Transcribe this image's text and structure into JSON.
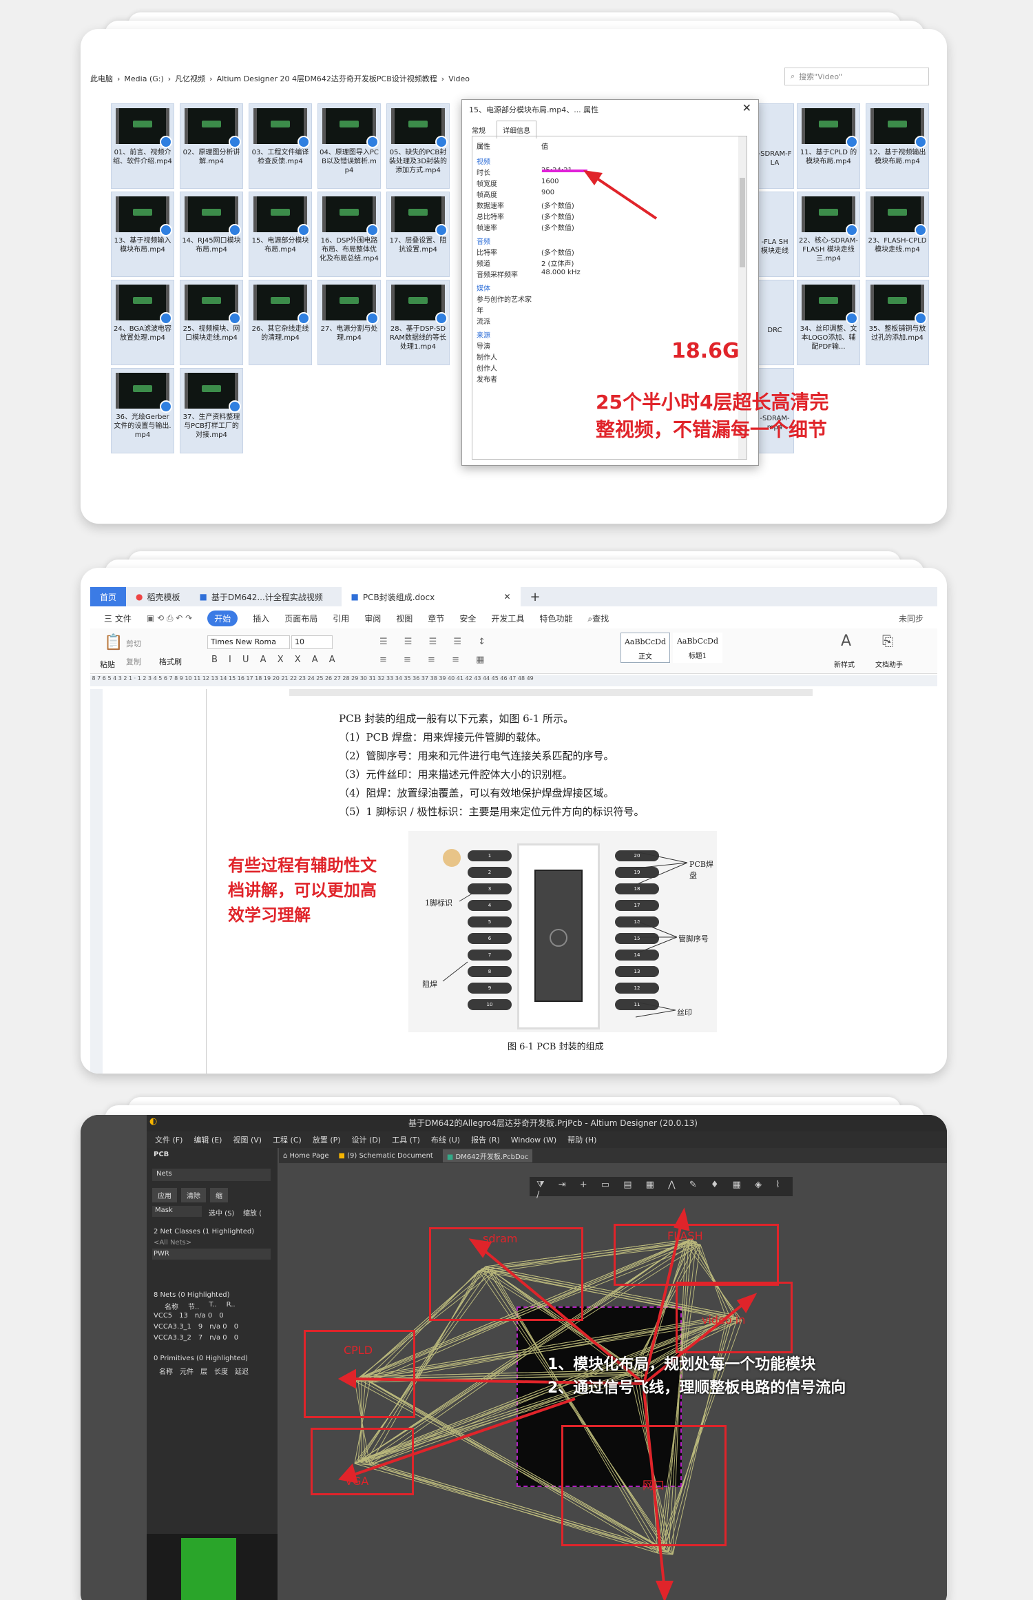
{
  "explorer": {
    "breadcrumb": [
      "此电脑",
      "Media (G:)",
      "凡亿视频",
      "Altium Designer 20 4层DM642达芬奇开发板PCB设计视频教程",
      "Video"
    ],
    "search_placeholder": "搜索\"Video\"",
    "files": [
      "01、前言、视频介绍、软件介绍.mp4",
      "02、原理图分析讲解.mp4",
      "03、工程文件编译检查反馈.mp4",
      "04、原理图导入PCB以及错误解析.mp4",
      "05、缺失的PCB封装处理及3D封装的添加方式.mp4",
      "11、基于CPLD 的模块布局.mp4",
      "12、基于视频输出模块布局.mp4",
      "13、基于视频输入模块布局.mp4",
      "14、RJ45网口模块布局.mp4",
      "15、电源部分模块布局.mp4",
      "16、DSP外围电路布局、布局整体优化及布局总结.mp4",
      "17、层叠设置、阻抗设置.mp4",
      "22、核心-SDRAM-FLASH 模块走线三.mp4",
      "23、FLASH-CPLD模块走线.mp4",
      "24、BGA滤波电容放置处理.mp4",
      "25、视频模块、网口模块走线.mp4",
      "26、其它杂线走线的清理.mp4",
      "27、电源分割与处理.mp4",
      "28、基于DSP-SDRAM数据线的等长处理1.mp4",
      "34、丝印调整、文本LOGO添加、辅配PDF输...",
      "35、整板铺铜与放过孔的添加.mp4",
      "36、光绘Gerber文件的设置与输出.mp4",
      "37、生产资料整理与PCB打样工厂的对接.mp4"
    ],
    "partial_files": [
      "-SDRAM-FLA",
      "-FLA SH 模块走线",
      "DRC",
      "-SDRAM-mp4"
    ],
    "dialog": {
      "title": "15、电源部分模块布局.mp4、... 属性",
      "tabs": [
        "常规",
        "详细信息"
      ],
      "col_headers": [
        "属性",
        "值"
      ],
      "sections": [
        {
          "header": "视频",
          "rows": [
            [
              "时长",
              "25:24:21"
            ],
            [
              "帧宽度",
              "1600"
            ],
            [
              "帧高度",
              "900"
            ],
            [
              "数据速率",
              "(多个数值)"
            ],
            [
              "总比特率",
              "(多个数值)"
            ],
            [
              "帧速率",
              "(多个数值)"
            ]
          ]
        },
        {
          "header": "音频",
          "rows": [
            [
              "比特率",
              "(多个数值)"
            ],
            [
              "频道",
              "2 (立体声)"
            ],
            [
              "音频采样频率",
              "48.000 kHz"
            ]
          ]
        },
        {
          "header": "媒体",
          "rows": [
            [
              "参与创作的艺术家",
              ""
            ],
            [
              "年",
              ""
            ],
            [
              "流派",
              ""
            ]
          ]
        },
        {
          "header": "来源",
          "rows": [
            [
              "导演",
              ""
            ],
            [
              "制作人",
              ""
            ],
            [
              "创作人",
              ""
            ],
            [
              "发布者",
              ""
            ]
          ]
        }
      ]
    },
    "size_callout": "18.6G",
    "callout": [
      "25个半小时4层超长高清完",
      "整视频，不错漏每一个细节"
    ]
  },
  "word": {
    "tabs": [
      "首页",
      "稻壳模板",
      "基于DM642...计全程实战视频",
      "PCB封装组成.docx"
    ],
    "menu": [
      "三 文件",
      "开始",
      "插入",
      "页面布局",
      "引用",
      "审阅",
      "视图",
      "章节",
      "安全",
      "开发工具",
      "特色功能",
      "查找"
    ],
    "sync_label": "未同步",
    "font_name": "Times New Roma",
    "font_size": "10",
    "styles": [
      "AaBbCcDd",
      "AaBbCcDd"
    ],
    "style_names": [
      "正文",
      "标题1"
    ],
    "ribbon_left": [
      "粘贴",
      "剪切",
      "复制",
      "格式刷"
    ],
    "ribbon_right": [
      "新样式",
      "文档助手"
    ],
    "body_lines": [
      "PCB 封装的组成一般有以下元素，如图 6-1 所示。",
      "（1）PCB 焊盘：用来焊接元件管脚的载体。",
      "（2）管脚序号：用来和元件进行电气连接关系匹配的序号。",
      "（3）元件丝印：用来描述元件腔体大小的识别框。",
      "（4）阻焊：放置绿油覆盖，可以有效地保护焊盘焊接区域。",
      "（5）1 脚标识 / 极性标识：主要是用来定位元件方向的标识符号。"
    ],
    "figure_labels": {
      "pad": "PCB焊盘",
      "pin_no": "管脚序号",
      "silk": "丝印",
      "pin1": "1脚标识",
      "mask": "阻焊"
    },
    "caption": "图 6-1   PCB 封装的组成",
    "callout": [
      "有些过程有辅助性文",
      "档讲解，可以更加高",
      "效学习理解"
    ]
  },
  "altium": {
    "title": "基于DM642的Allegro4层达芬奇开发板.PrjPcb - Altium Designer (20.0.13)",
    "menu": [
      "文件 (F)",
      "编辑 (E)",
      "视图 (V)",
      "工程 (C)",
      "放置 (P)",
      "设计 (D)",
      "工具 (T)",
      "布线 (U)",
      "报告 (R)",
      "Window (W)",
      "帮助 (H)"
    ],
    "doc_tabs": [
      "Home Page",
      "(9) Schematic Document",
      "DM642开发板.PcbDoc"
    ],
    "panel": {
      "title": "PCB",
      "dropdown": "Nets",
      "buttons": [
        "应用",
        "清除",
        "缩"
      ],
      "mask": "Mask",
      "checks": [
        "选中 (S)",
        "缩放 ("
      ],
      "net_classes_header": "2 Net Classes (1 Highlighted)",
      "net_classes": [
        "<All Nets>",
        "PWR"
      ],
      "nets_header": "8 Nets (0 Highlighted)",
      "nets_cols": [
        "名称",
        "节..",
        "T..",
        "R.."
      ],
      "nets": [
        [
          "VCC5",
          "13",
          "n/a 0",
          "0"
        ],
        [
          "VCCA3.3_1",
          "9",
          "n/a 0",
          "0"
        ],
        [
          "VCCA3.3_2",
          "7",
          "n/a 0",
          "0"
        ]
      ],
      "primitives_header": "0 Primitives (0 Highlighted)",
      "primitives_cols": [
        "名称",
        "元件",
        "层",
        "长度",
        "延迟"
      ]
    },
    "modules": [
      "sdram",
      "FLASH",
      "video in",
      "CPLD",
      "VGA",
      "网口"
    ],
    "callout": [
      "1、模块化布局，规划处每一个功能模块",
      "2、通过信号飞线，理顺整板电路的信号流向"
    ]
  }
}
